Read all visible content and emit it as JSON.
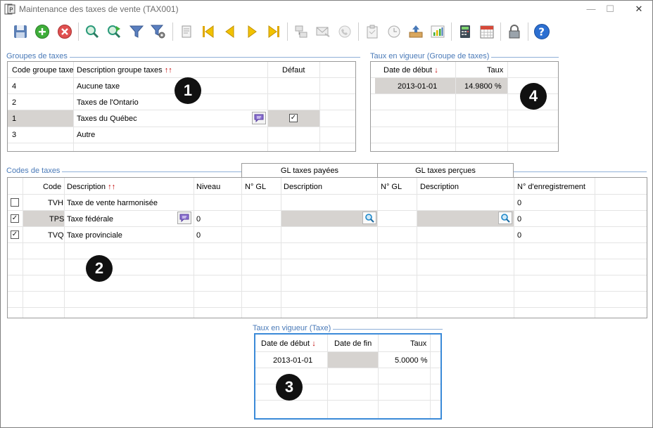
{
  "window": {
    "title": "Maintenance des taxes de vente (TAX001)"
  },
  "tax_groups": {
    "label": "Groupes de taxes",
    "headers": {
      "code": "Code groupe taxe",
      "description": "Description groupe taxes",
      "default": "Défaut"
    },
    "rows": [
      {
        "code": "4",
        "description": "Aucune taxe",
        "default": false
      },
      {
        "code": "2",
        "description": "Taxes de l'Ontario",
        "default": false
      },
      {
        "code": "1",
        "description": "Taxes du Québec",
        "default": true
      },
      {
        "code": "3",
        "description": "Autre",
        "default": false
      }
    ]
  },
  "group_rates": {
    "label": "Taux en vigueur (Groupe de taxes)",
    "headers": {
      "start": "Date de début",
      "rate": "Taux"
    },
    "rows": [
      {
        "start": "2013-01-01",
        "rate": "14.9800 %"
      }
    ]
  },
  "tax_codes": {
    "label": "Codes de taxes",
    "tab_paid": "GL taxes payées",
    "tab_received": "GL taxes perçues",
    "headers": {
      "code": "Code",
      "description": "Description",
      "level": "Niveau",
      "gl_paid_no": "N° GL",
      "gl_paid_desc": "Description",
      "gl_recv_no": "N° GL",
      "gl_recv_desc": "Description",
      "registration": "N° d'enregistrement"
    },
    "rows": [
      {
        "checked": false,
        "code": "TVH",
        "description": "Taxe de vente harmonisée",
        "level": "",
        "registration": "0"
      },
      {
        "checked": true,
        "code": "TPS",
        "description": "Taxe fédérale",
        "level": "0",
        "registration": "0"
      },
      {
        "checked": true,
        "code": "TVQ",
        "description": "Taxe provinciale",
        "level": "0",
        "registration": "0"
      }
    ]
  },
  "tax_rates": {
    "label": "Taux en vigueur (Taxe)",
    "headers": {
      "start": "Date de début",
      "end": "Date de fin",
      "rate": "Taux"
    },
    "rows": [
      {
        "start": "2013-01-01",
        "end": "",
        "rate": "5.0000 %"
      }
    ]
  },
  "callouts": [
    "1",
    "2",
    "3",
    "4"
  ],
  "colors": {
    "group_label": "#4a7ab8",
    "selection": "#d6d3d0",
    "sort_arrow": "#c00000"
  }
}
